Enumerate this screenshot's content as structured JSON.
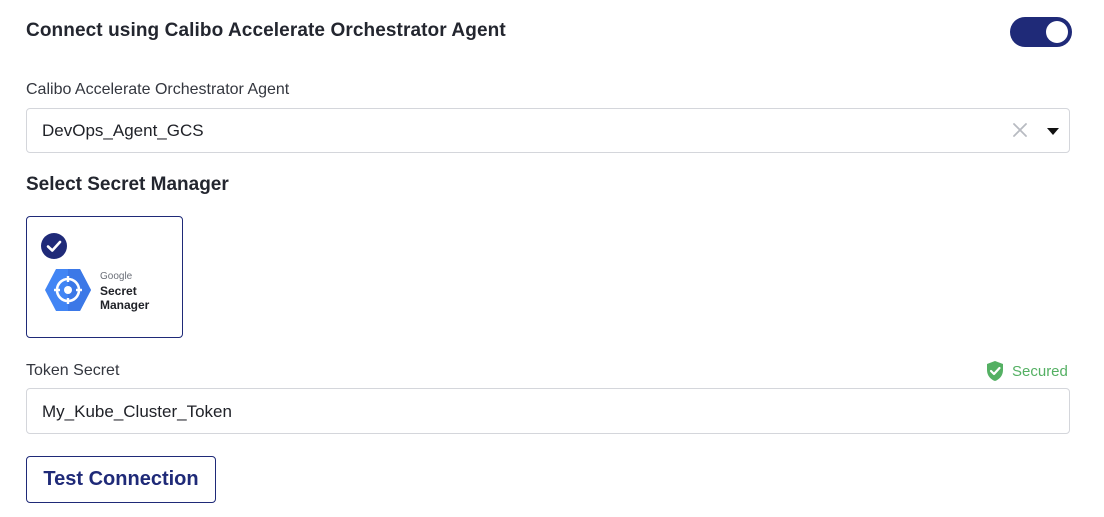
{
  "connect": {
    "title": "Connect using Calibo Accelerate Orchestrator Agent",
    "toggle_on": true,
    "toggle_color": "#1f2a78"
  },
  "agent": {
    "label": "Calibo Accelerate Orchestrator Agent",
    "value": "DevOps_Agent_GCS",
    "clear_icon": "close-icon",
    "dropdown_icon": "caret-down-icon"
  },
  "secret_manager": {
    "title": "Select Secret Manager",
    "options": [
      {
        "brand": "Google",
        "name_line1": "Secret",
        "name_line2": "Manager",
        "selected": true,
        "icon": "google-secret-manager-logo"
      }
    ]
  },
  "token": {
    "label": "Token Secret",
    "status": "Secured",
    "status_color": "#54b063",
    "value": "My_Kube_Cluster_Token"
  },
  "actions": {
    "test_connection_label": "Test Connection"
  },
  "colors": {
    "accent": "#1f2a78",
    "google_blue": "#4285f4"
  }
}
